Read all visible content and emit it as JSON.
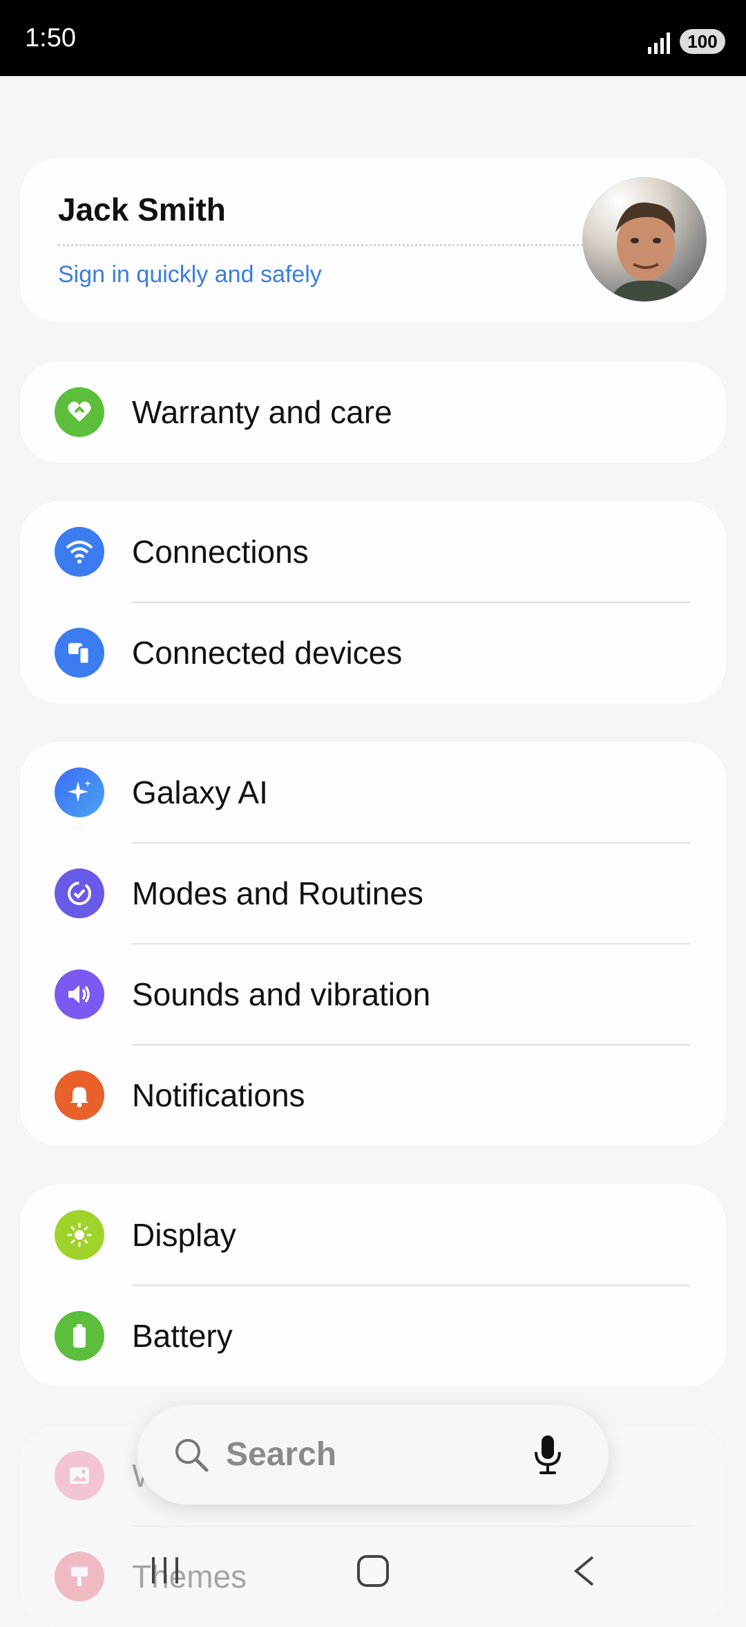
{
  "status_bar": {
    "time": "1:50",
    "battery": "100"
  },
  "profile": {
    "name": "Jack Smith",
    "subtitle": "Sign in quickly and safely"
  },
  "groups": [
    [
      {
        "label": "Warranty and care",
        "icon": "heart-icon",
        "color": "#5bbf3c"
      }
    ],
    [
      {
        "label": "Connections",
        "icon": "wifi-icon",
        "color": "#3b7df0"
      },
      {
        "label": "Connected devices",
        "icon": "devices-icon",
        "color": "#3b7df0"
      }
    ],
    [
      {
        "label": "Galaxy AI",
        "icon": "sparkle-icon",
        "color": "#4a7cf4"
      },
      {
        "label": "Modes and Routines",
        "icon": "check-circle-icon",
        "color": "#6a5ae8"
      },
      {
        "label": "Sounds and vibration",
        "icon": "speaker-icon",
        "color": "#7a5af0"
      },
      {
        "label": "Notifications",
        "icon": "bell-icon",
        "color": "#e8612a"
      }
    ],
    [
      {
        "label": "Display",
        "icon": "sun-icon",
        "color": "#9fd32a"
      },
      {
        "label": "Battery",
        "icon": "battery-icon",
        "color": "#5bbf3c"
      }
    ],
    [
      {
        "label": "Wallpaper and style",
        "icon": "image-icon",
        "color": "#ef6e8e"
      },
      {
        "label": "Themes",
        "icon": "brush-icon",
        "color": "#e8506a"
      }
    ]
  ],
  "search": {
    "placeholder": "Search"
  }
}
